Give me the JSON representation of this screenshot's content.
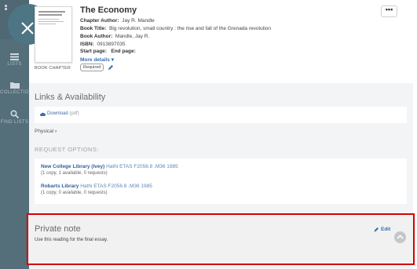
{
  "rail": {
    "items": [
      {
        "label": "LISTS",
        "icon": "list-icon"
      },
      {
        "label": "COLLECTIONS",
        "icon": "folder-icon"
      },
      {
        "label": "FIND LISTS",
        "icon": "search-icon"
      }
    ]
  },
  "record": {
    "doc_type": "BOOK CHAPTER",
    "title": "The Economy",
    "fields": [
      {
        "label": "Chapter Author:",
        "value": "Jay R. Mandle"
      },
      {
        "label": "Book Title:",
        "value": "Big revolution, small country : the rise and fall of the Grenada revolution"
      },
      {
        "label": "Book Author:",
        "value": "Mandle, Jay R."
      },
      {
        "label": "ISBN:",
        "value": "0913897035"
      }
    ],
    "start_page_label": "Start page:",
    "end_page_label": "End page:",
    "more_details": "More details",
    "required_badge": "Required"
  },
  "links": {
    "section_title": "Links & Availability",
    "download_label": "Download",
    "download_type": "(pdf)",
    "physical_label": "Physical"
  },
  "request": {
    "title": "REQUEST OPTIONS:",
    "libraries": [
      {
        "name": "New College Library (Ivey)",
        "location": "Hathi ETAS F2056.8 .M36 1985",
        "availability": "(1 copy, 1 available, 0 requests)"
      },
      {
        "name": "Robarts Library",
        "location": "Hathi ETAS F2056.8 .M36 1985",
        "availability": "(1 copy, 0 available, 0 requests)"
      }
    ]
  },
  "note": {
    "title": "Private note",
    "text": "Use this reading for the final essay.",
    "edit_label": "Edit"
  },
  "colors": {
    "rail": "#546e7a",
    "link": "#3d6ea8",
    "highlight": "#d50000"
  }
}
